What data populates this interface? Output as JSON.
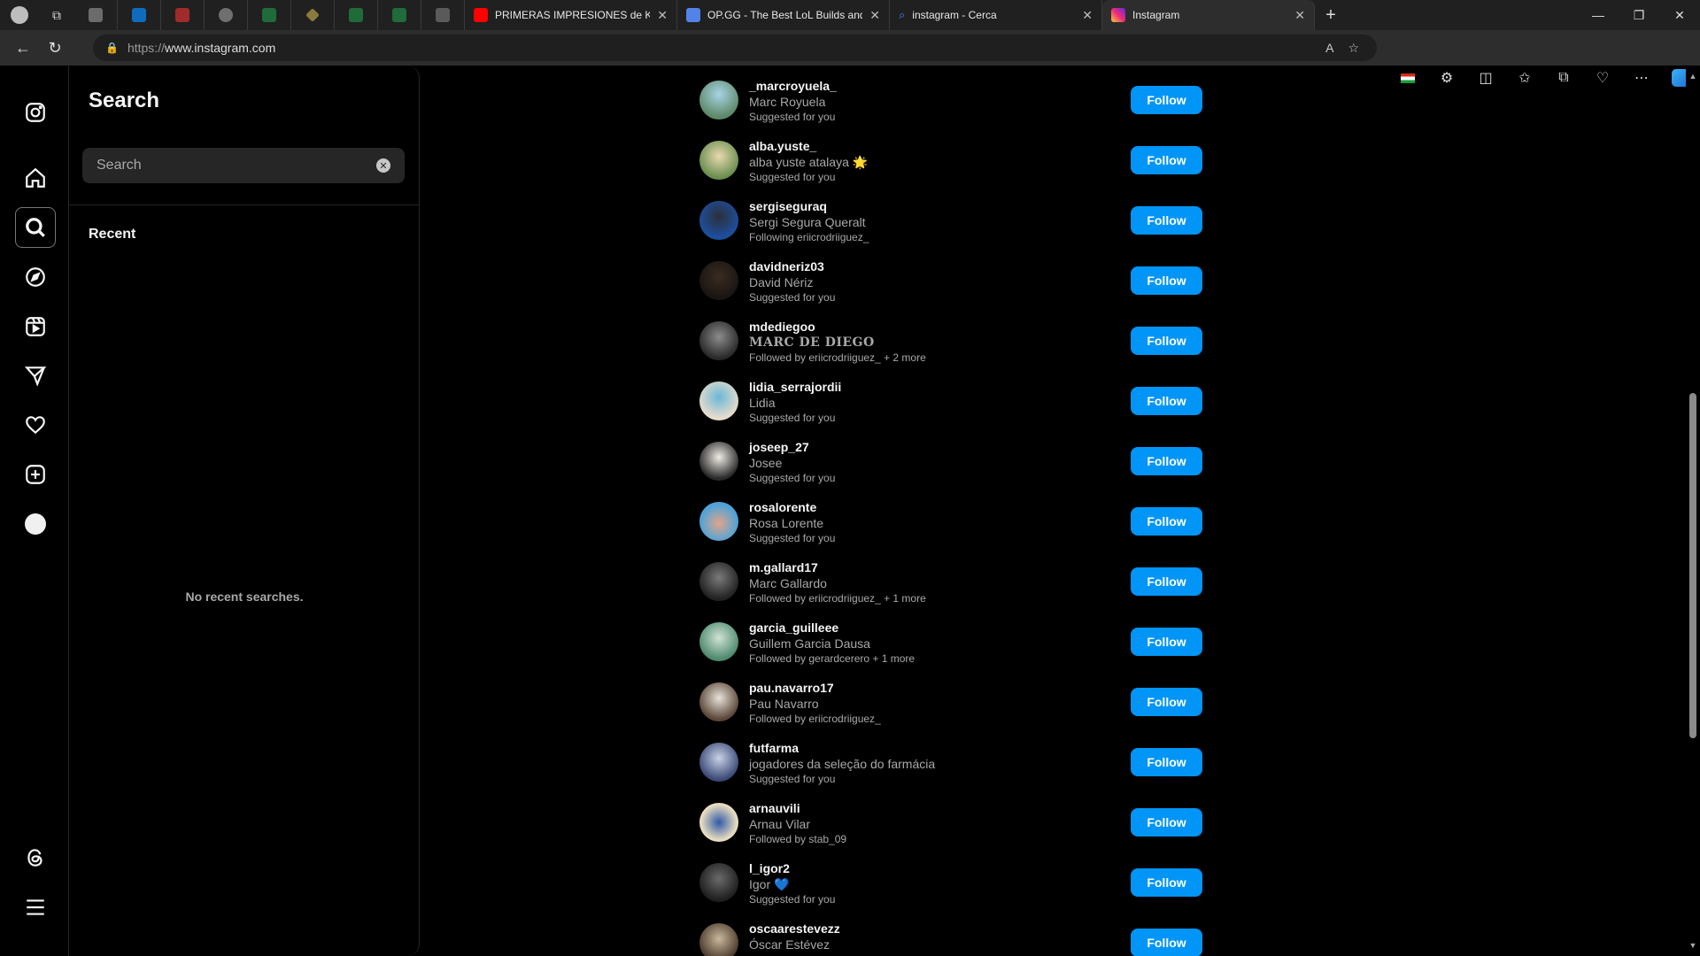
{
  "browser": {
    "tabs": [
      {
        "title": "PRIMERAS IMPRESIONES de K",
        "favicon": "youtube-icon",
        "color": "#ff0000"
      },
      {
        "title": "OP.GG - The Best LoL Builds and",
        "favicon": "opgg-icon",
        "color": "#5383e8"
      },
      {
        "title": "instagram - Cerca",
        "favicon": "search-icon",
        "color": "#3b82f6"
      },
      {
        "title": "Instagram",
        "favicon": "instagram-icon",
        "color": "#e1306c"
      }
    ],
    "url_protocol": "https://",
    "url_host": "www.instagram.com"
  },
  "search": {
    "title": "Search",
    "placeholder": "Search",
    "recent_label": "Recent",
    "empty_text": "No recent searches."
  },
  "suggestions": [
    {
      "username": "_marcroyuela_",
      "full_name": "Marc Royuela",
      "context": "Suggested for you",
      "follow_label": "Follow"
    },
    {
      "username": "alba.yuste_",
      "full_name": "alba yuste atalaya 🌟",
      "context": "Suggested for you",
      "follow_label": "Follow"
    },
    {
      "username": "sergiseguraq",
      "full_name": "Sergi Segura Queralt",
      "context": "Following eriicrodriiguez_",
      "follow_label": "Follow"
    },
    {
      "username": "davidneriz03",
      "full_name": "David Nériz",
      "context": "Suggested for you",
      "follow_label": "Follow"
    },
    {
      "username": "mdediegoo",
      "full_name": "MARC DE DIEGO",
      "context": "Followed by eriicrodriiguez_ + 2 more",
      "follow_label": "Follow"
    },
    {
      "username": "lidia_serrajordii",
      "full_name": "Lidia",
      "context": "Suggested for you",
      "follow_label": "Follow"
    },
    {
      "username": "joseep_27",
      "full_name": "Josee",
      "context": "Suggested for you",
      "follow_label": "Follow"
    },
    {
      "username": "rosalorente",
      "full_name": "Rosa Lorente",
      "context": "Suggested for you",
      "follow_label": "Follow"
    },
    {
      "username": "m.gallard17",
      "full_name": "Marc Gallardo",
      "context": "Followed by eriicrodriiguez_ + 1 more",
      "follow_label": "Follow"
    },
    {
      "username": "garcia_guilleee",
      "full_name": "Guillem Garcia Dausa",
      "context": "Followed by gerardcerero + 1 more",
      "follow_label": "Follow"
    },
    {
      "username": "pau.navarro17",
      "full_name": "Pau Navarro",
      "context": "Followed by eriicrodriiguez_",
      "follow_label": "Follow"
    },
    {
      "username": "futfarma",
      "full_name": "jogadores da seleção do farmácia",
      "context": "Suggested for you",
      "follow_label": "Follow"
    },
    {
      "username": "arnauvili",
      "full_name": "Arnau Vilar",
      "context": "Followed by stab_09",
      "follow_label": "Follow"
    },
    {
      "username": "l_igor2",
      "full_name": "Igor 💙",
      "context": "Suggested for you",
      "follow_label": "Follow"
    },
    {
      "username": "oscaarestevezz",
      "full_name": "Óscar Estévez",
      "context": "",
      "follow_label": "Follow"
    }
  ],
  "colors": {
    "accent": "#0095f6",
    "background": "#000000",
    "secondary_text": "#a8a8a8"
  }
}
